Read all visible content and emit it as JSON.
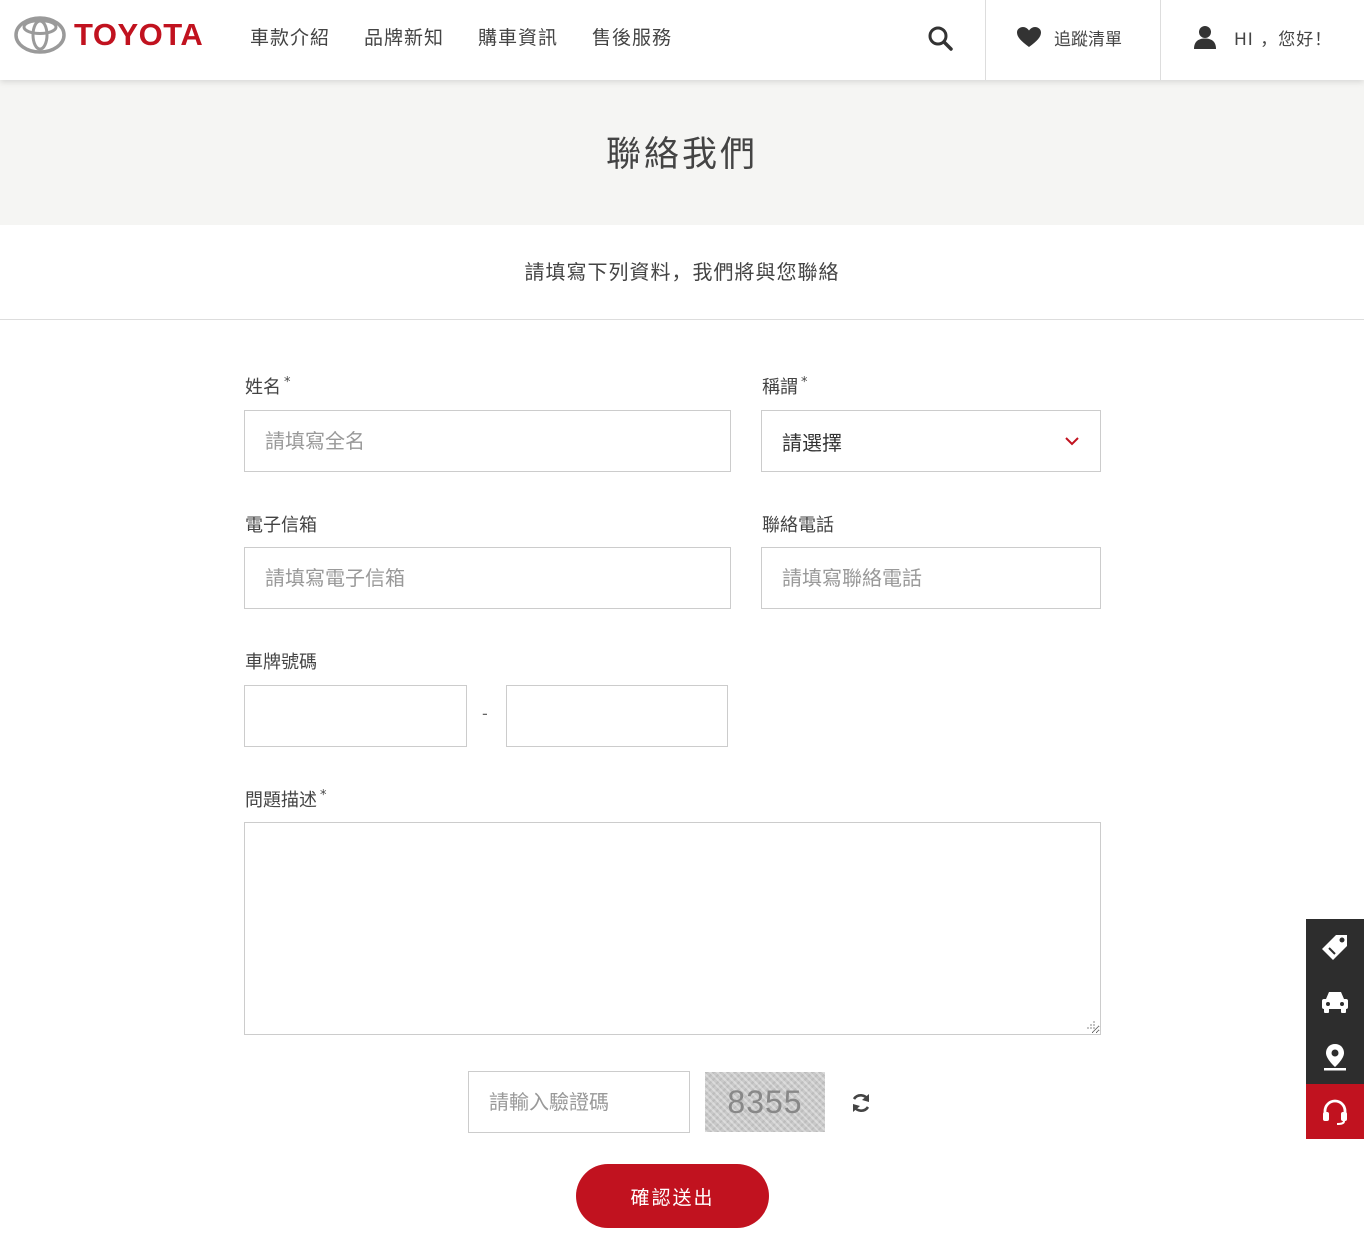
{
  "header": {
    "brand": "TOYOTA",
    "nav": [
      "車款介紹",
      "品牌新知",
      "購車資訊",
      "售後服務"
    ],
    "wishlist_label": "追蹤清單",
    "user_label": "HI ，您好！"
  },
  "banner": {
    "title": "聯絡我們"
  },
  "intro": "請填寫下列資料，我們將與您聯絡",
  "form": {
    "name": {
      "label": "姓名",
      "required": "*",
      "placeholder": "請填寫全名"
    },
    "title": {
      "label": "稱謂",
      "required": "*",
      "value": "請選擇"
    },
    "email": {
      "label": "電子信箱",
      "placeholder": "請填寫電子信箱"
    },
    "phone": {
      "label": "聯絡電話",
      "placeholder": "請填寫聯絡電話"
    },
    "plate": {
      "label": "車牌號碼",
      "separator": "-"
    },
    "description": {
      "label": "問題描述",
      "required": "*"
    },
    "captcha": {
      "placeholder": "請輸入驗證碼",
      "code": "8355"
    },
    "submit_label": "確認送出"
  },
  "sidebar": [
    "price-tag-icon",
    "car-icon",
    "location-pin-icon",
    "headset-icon"
  ],
  "colors": {
    "brand_red": "#c1121f",
    "sidebar_dark": "#2d2d2d",
    "banner_bg": "#f5f5f3"
  }
}
